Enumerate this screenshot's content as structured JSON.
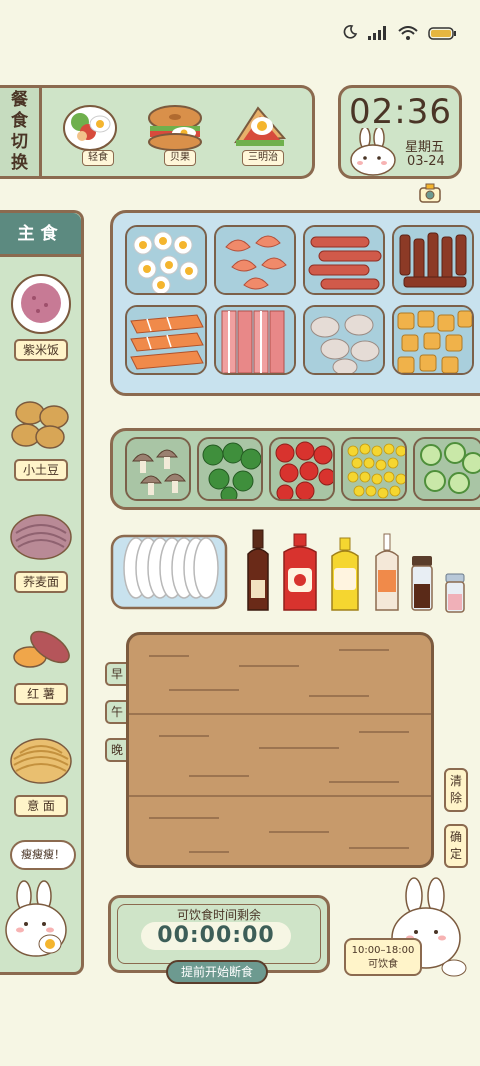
{
  "meal_switch": {
    "title_chars": [
      "餐",
      "食",
      "切",
      "换"
    ],
    "options": [
      {
        "label": "轻食"
      },
      {
        "label": "贝果"
      },
      {
        "label": "三明治"
      }
    ]
  },
  "clock": {
    "time": "02:36",
    "weekday": "星期五",
    "date": "03-24"
  },
  "staples": {
    "title": "主食",
    "items": [
      {
        "label": "紫米饭"
      },
      {
        "label": "小土豆"
      },
      {
        "label": "荞麦面"
      },
      {
        "label": "红 薯"
      },
      {
        "label": "意 面"
      }
    ],
    "speech": "瘦瘦瘦！"
  },
  "meal_tabs": [
    "早",
    "午",
    "晚"
  ],
  "actions": {
    "clear": [
      "清",
      "除"
    ],
    "confirm": [
      "确",
      "定"
    ]
  },
  "timer": {
    "title": "可饮食时间剩余",
    "value": "00:00:00",
    "start_fast_label": "提前开始断食"
  },
  "eating_window": {
    "range": "10:00–18:00",
    "label": "可饮食"
  },
  "colors": {
    "panel_green": "#cfe4c8",
    "accent_teal": "#5c8a80",
    "border_brown": "#8b6a4f",
    "background": "#f6f6e4"
  }
}
